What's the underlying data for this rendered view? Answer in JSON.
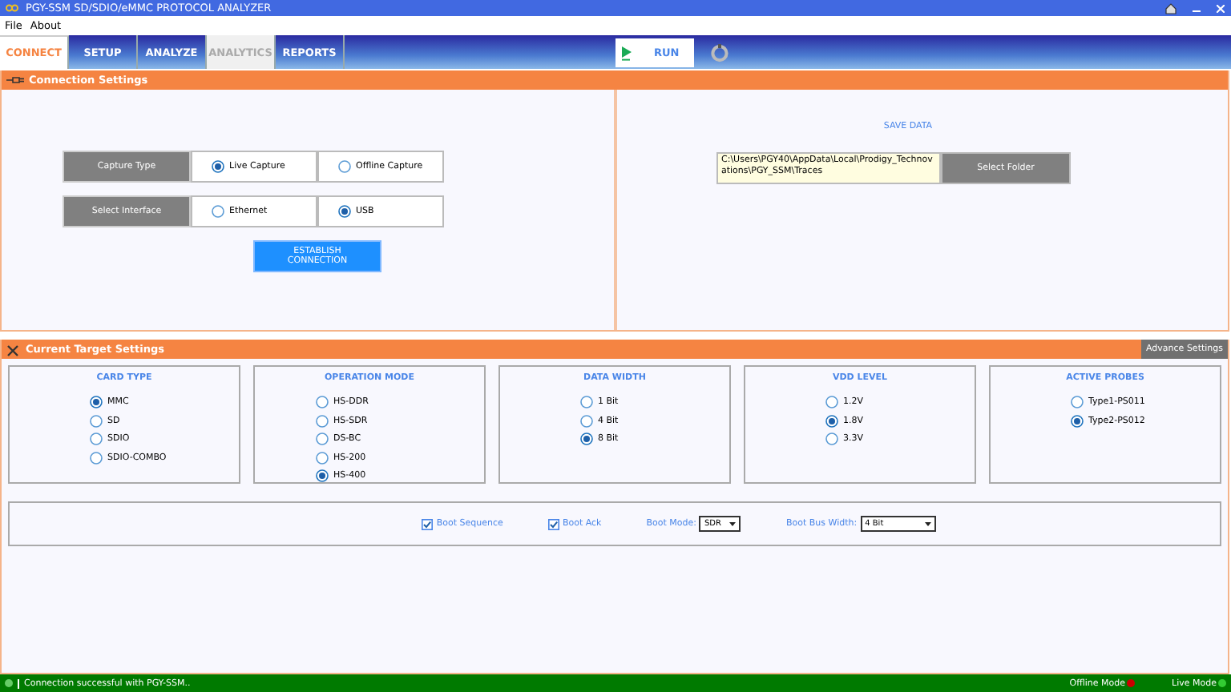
{
  "window": {
    "title": "PGY-SSM SD/SDIO/eMMC PROTOCOL ANALYZER"
  },
  "menu": [
    "File",
    "About"
  ],
  "tabs": [
    {
      "label": "CONNECT",
      "selected": true,
      "disabled": false
    },
    {
      "label": "SETUP",
      "selected": false,
      "disabled": false
    },
    {
      "label": "ANALYZE",
      "selected": false,
      "disabled": false
    },
    {
      "label": "ANALYTICS",
      "selected": false,
      "disabled": true
    },
    {
      "label": "REPORTS",
      "selected": false,
      "disabled": false
    }
  ],
  "run_button": {
    "label": "RUN"
  },
  "connection_settings": {
    "title": "Connection Settings",
    "rows": [
      {
        "label": "Capture Type",
        "options": [
          {
            "label": "Live Capture",
            "selected": true
          },
          {
            "label": "Offline Capture",
            "selected": false
          }
        ]
      },
      {
        "label": "Select Interface",
        "options": [
          {
            "label": "Ethernet",
            "selected": false
          },
          {
            "label": "USB",
            "selected": true
          }
        ]
      }
    ],
    "connect_button": "ESTABLISH CONNECTION",
    "save_data": {
      "title": "SAVE DATA",
      "path": "C:\\Users\\PGY40\\AppData\\Local\\Prodigy_Technovations\\PGY_SSM\\Traces",
      "button": "Select Folder"
    }
  },
  "target_settings": {
    "title": "Current Target Settings",
    "advance_button": "Advance Settings",
    "groups": [
      {
        "title": "CARD TYPE",
        "options": [
          {
            "label": "MMC",
            "selected": true
          },
          {
            "label": "SD",
            "selected": false
          },
          {
            "label": "SDIO",
            "selected": false
          },
          {
            "label": "SDIO-COMBO",
            "selected": false
          }
        ]
      },
      {
        "title": "OPERATION MODE",
        "options": [
          {
            "label": "HS-DDR",
            "selected": false
          },
          {
            "label": "HS-SDR",
            "selected": false
          },
          {
            "label": "DS-BC",
            "selected": false
          },
          {
            "label": "HS-200",
            "selected": false
          },
          {
            "label": "HS-400",
            "selected": true
          }
        ]
      },
      {
        "title": "DATA WIDTH",
        "options": [
          {
            "label": "1 Bit",
            "selected": false
          },
          {
            "label": "4 Bit",
            "selected": false
          },
          {
            "label": "8 Bit",
            "selected": true
          }
        ]
      },
      {
        "title": "VDD LEVEL",
        "options": [
          {
            "label": "1.2V",
            "selected": false
          },
          {
            "label": "1.8V",
            "selected": true
          },
          {
            "label": "3.3V",
            "selected": false
          }
        ]
      },
      {
        "title": "ACTIVE PROBES",
        "options": [
          {
            "label": "Type1-PS011",
            "selected": false
          },
          {
            "label": "Type2-PS012",
            "selected": true
          }
        ]
      }
    ],
    "boot": [
      {
        "kind": "checkbox",
        "label": "Boot Sequence",
        "checked": true
      },
      {
        "kind": "checkbox",
        "label": "Boot Ack",
        "checked": true
      },
      {
        "kind": "dropdown",
        "label": "Boot Mode:",
        "value": "SDR"
      },
      {
        "kind": "dropdown",
        "label": "Boot Bus Width:",
        "value": "4 Bit"
      }
    ]
  },
  "status_bar": {
    "message": "Connection successful with PGY-SSM..",
    "indicators": [
      {
        "label": "Offline Mode",
        "color": "#cc0000"
      },
      {
        "label": "Live Mode",
        "color": "#33cc33"
      }
    ]
  }
}
